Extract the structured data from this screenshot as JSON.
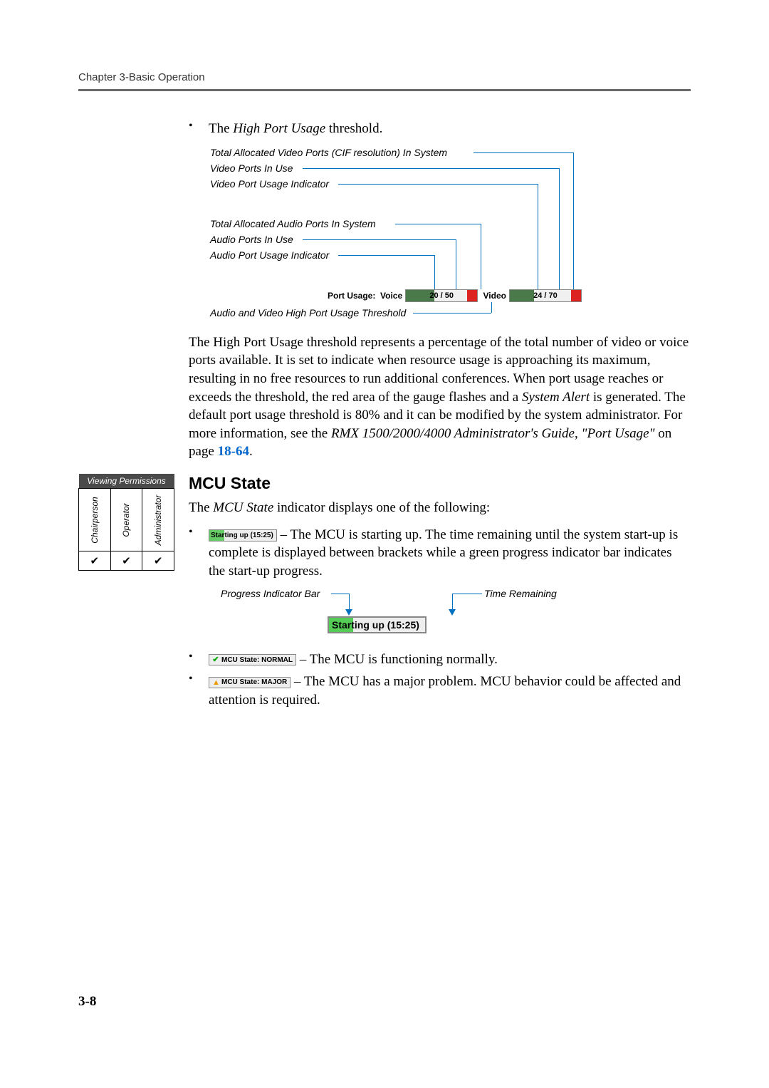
{
  "header": {
    "text": "Chapter 3-Basic Operation"
  },
  "bullet1": {
    "pre": "The ",
    "em": "High Port Usage",
    "post": " threshold."
  },
  "diagram1": {
    "l1": "Total Allocated Video Ports (CIF resolution) In System",
    "l2": "Video Ports In Use",
    "l3": "Video Port Usage Indicator",
    "l4": "Total Allocated Audio Ports In System",
    "l5": "Audio Ports In Use",
    "l6": "Audio Port Usage Indicator",
    "l7": "Audio and Video High Port Usage Threshold",
    "bar_label": "Port Usage:",
    "voice_label": "Voice",
    "voice_value": "20 / 50",
    "video_label": "Video",
    "video_value": "24 / 70"
  },
  "para1": {
    "t1": "The High Port Usage threshold represents a percentage of the total number of video or voice ports available. It is set to indicate when resource usage is approaching its maximum, resulting in no free resources to run additional conferences. When port usage reaches or exceeds the threshold, the red area of the gauge flashes and a ",
    "em1": "System Alert",
    "t2": " is generated. The default port usage threshold is 80% and it can be modified by the system administrator. For more information, see the ",
    "em2": "RMX 1500/2000/4000 Administrator's Guide",
    "t3": ", ",
    "em3": "\"Port Usage\"",
    "t4": " on page ",
    "link": "18-64",
    "t5": "."
  },
  "perm": {
    "title": "Viewing Permissions",
    "col1": "Chairperson",
    "col2": "Operator",
    "col3": "Administrator",
    "check": "✔"
  },
  "mcu": {
    "heading": "MCU State",
    "intro_pre": "The ",
    "intro_em": "MCU State",
    "intro_post": " indicator displays one of the following:",
    "b1": {
      "badge": "Starting up (15:25)",
      "text": " – The MCU is starting up. The time remaining until the system start-up is complete is displayed between brackets while a green progress indicator bar indicates the start-up progress."
    },
    "pdiag": {
      "l1": "Progress Indicator Bar",
      "l2": "Time Remaining",
      "badge": "Starting up (15:25)"
    },
    "b2": {
      "badge": "MCU State: NORMAL",
      "text": " – The MCU is functioning normally."
    },
    "b3": {
      "badge": "MCU State: MAJOR",
      "text": " – The MCU has a major problem. MCU behavior could be affected and attention is required."
    }
  },
  "pageno": "3-8"
}
